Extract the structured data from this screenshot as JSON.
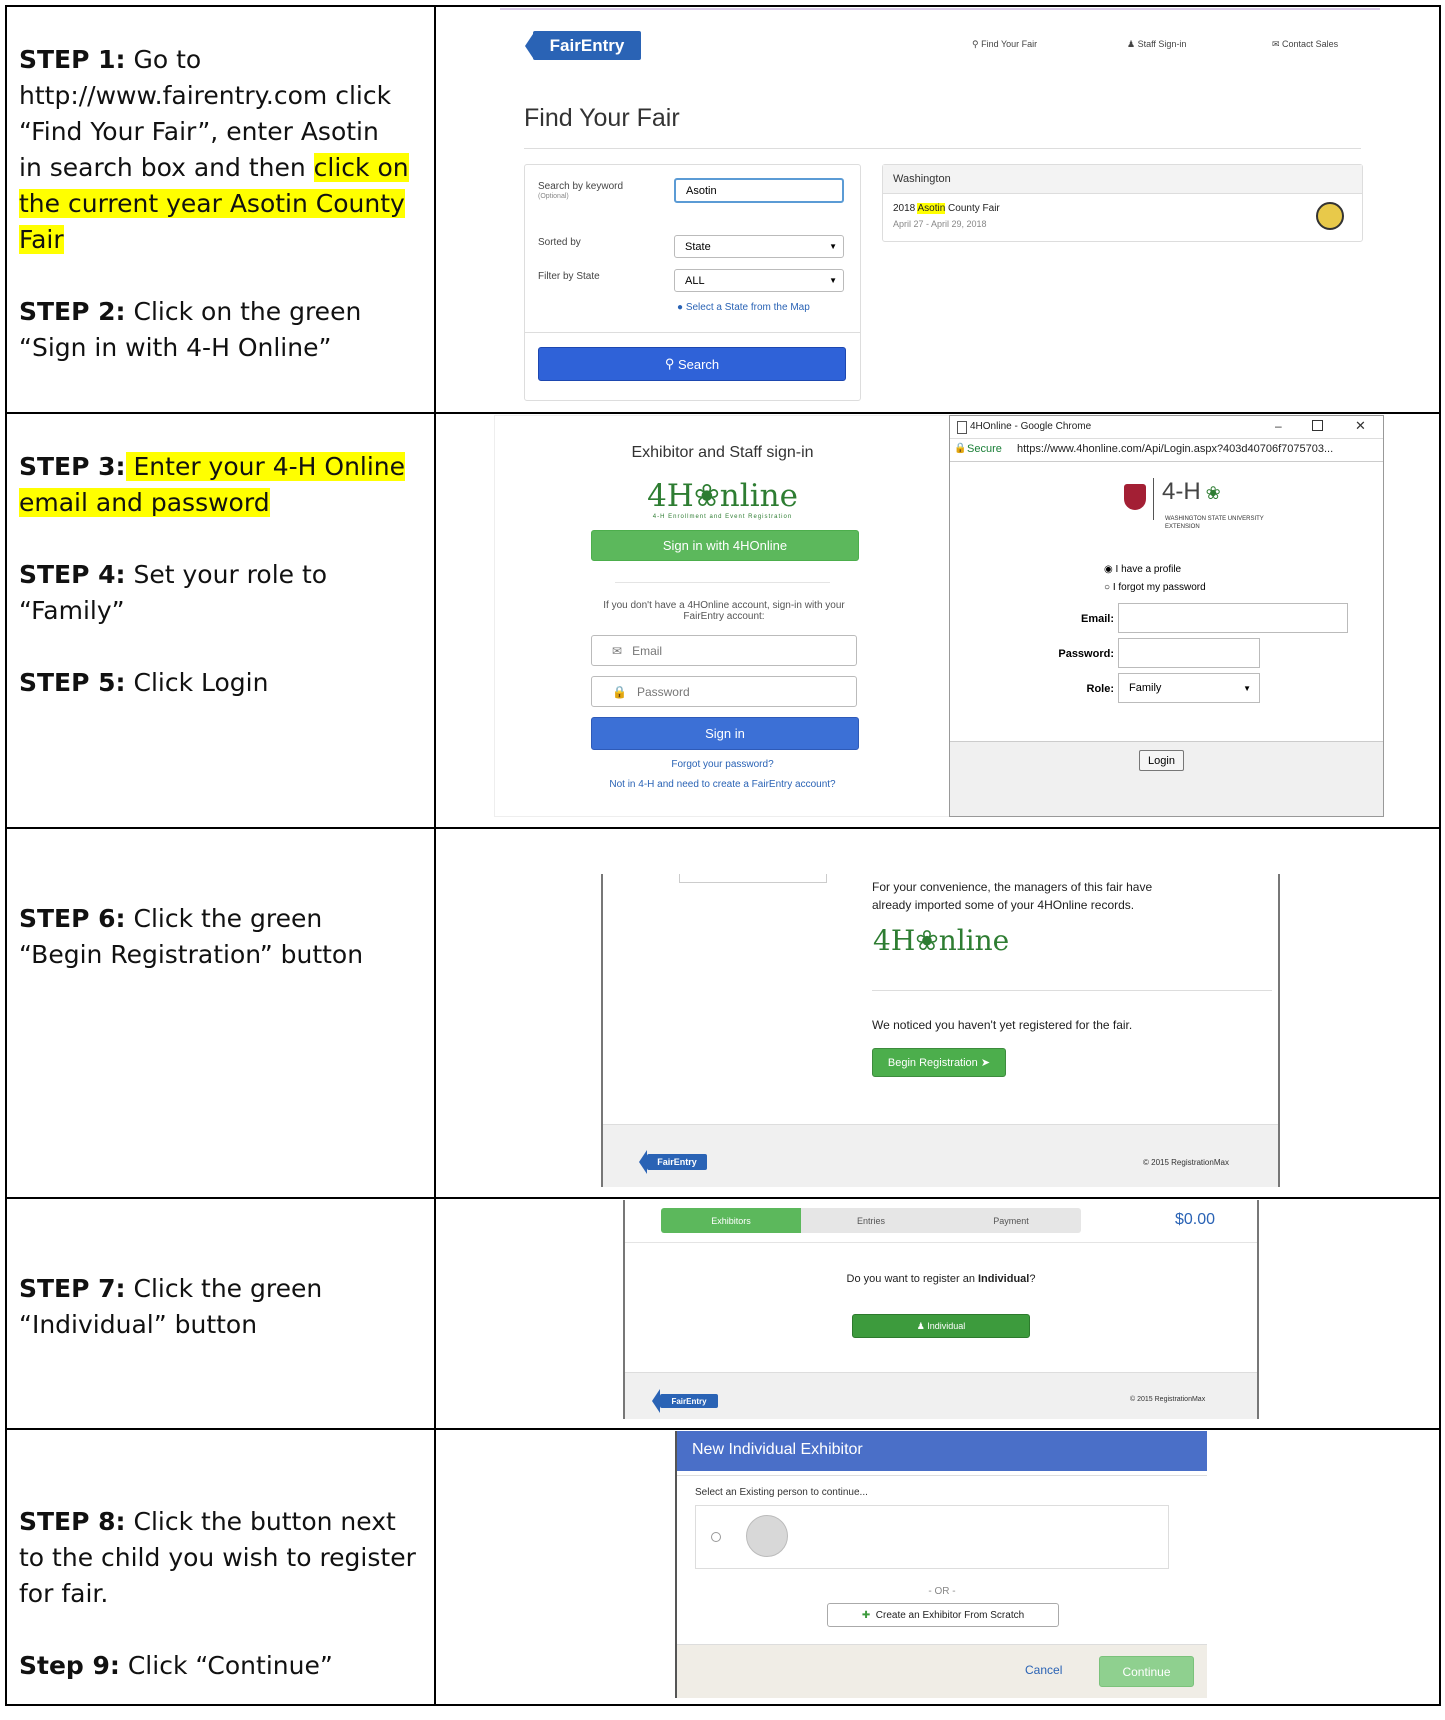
{
  "rows": [
    {
      "steps": [
        {
          "label": "STEP 1:",
          "text": " Go to http://www.fairentry.com click “Find Your Fair”, enter Asotin in search box and then ",
          "highlight": "click on the current year Asotin County Fair"
        },
        {
          "label": "STEP 2:",
          "text": " Click on the green “Sign in with 4-H Online”"
        }
      ]
    },
    {
      "steps": [
        {
          "label": "STEP 3:",
          "highlight": " Enter your 4-H Online email and password"
        },
        {
          "label": "STEP 4:",
          "text": " Set your role to “Family”"
        },
        {
          "label": "STEP 5:",
          "text": " Click Login"
        }
      ]
    },
    {
      "steps": [
        {
          "label": "STEP 6:",
          "text": " Click the green “Begin Registration” button"
        }
      ]
    },
    {
      "steps": [
        {
          "label": "STEP 7:",
          "text": " Click the green “Individual” button"
        }
      ]
    },
    {
      "steps": [
        {
          "label": "STEP 8:",
          "text": " Click the button next to the child you wish to register for fair."
        },
        {
          "label": "Step 9:",
          "text": " Click “Continue”"
        }
      ]
    }
  ],
  "shot1": {
    "logo": "FairEntry",
    "nav": [
      "Find Your Fair",
      "Staff Sign-in",
      "Contact Sales"
    ],
    "title": "Find Your Fair",
    "search_label": "Search by keyword",
    "search_optional": "(Optional)",
    "search_value": "Asotin",
    "sorted_label": "Sorted by",
    "sorted_value": "State",
    "filter_label": "Filter by State",
    "filter_value": "ALL",
    "map_link": "Select a State from the Map",
    "search_button": "Search",
    "result_state": "Washington",
    "result_year": "2018 ",
    "result_hl": "Asotin",
    "result_rest": " County Fair",
    "result_dates": "April 27 - April 29, 2018"
  },
  "shot2": {
    "heading": "Exhibitor and Staff sign-in",
    "fourh_logo": "4H❀nline",
    "fourh_tagline": "4-H Enrollment and Event Registration",
    "signin_4h": "Sign in with 4HOnline",
    "no_account": "If you don't have a 4HOnline account, sign-in with your FairEntry account:",
    "email_ph": "Email",
    "password_ph": "Password",
    "signin": "Sign in",
    "forgot": "Forgot your password?",
    "not_4h": "Not in 4-H and need to create a FairEntry account?",
    "window_title": "4HOnline - Google Chrome",
    "secure": "Secure",
    "url": "https://www.4honline.com/Api/Login.aspx?403d40706f7075703...",
    "fourh_mark": "4-H",
    "wsu": "WASHINGTON STATE UNIVERSITY",
    "extension": "EXTENSION",
    "radio1": "I have a profile",
    "radio2": "I forgot my password",
    "email_label": "Email:",
    "password_label": "Password:",
    "role_label": "Role:",
    "role_value": "Family",
    "login": "Login"
  },
  "shot3": {
    "convenience": "For your convenience, the managers of this fair have already imported some of your 4HOnline records.",
    "noticed": "We noticed you haven't yet registered for the fair.",
    "begin": "Begin Registration",
    "copyright": "© 2015 RegistrationMax",
    "logo": "FairEntry"
  },
  "shot4": {
    "steps": [
      "Exhibitors",
      "Entries",
      "Payment"
    ],
    "total": "$0.00",
    "question_pre": "Do you want to register an ",
    "question_bold": "Individual",
    "question_post": "?",
    "individual": "Individual",
    "copyright": "© 2015 RegistrationMax",
    "logo": "FairEntry"
  },
  "shot5": {
    "header": "New Individual Exhibitor",
    "select_text": "Select an Existing person to continue...",
    "or": "- OR -",
    "create": "Create an Exhibitor From Scratch",
    "cancel": "Cancel",
    "continue": "Continue"
  }
}
